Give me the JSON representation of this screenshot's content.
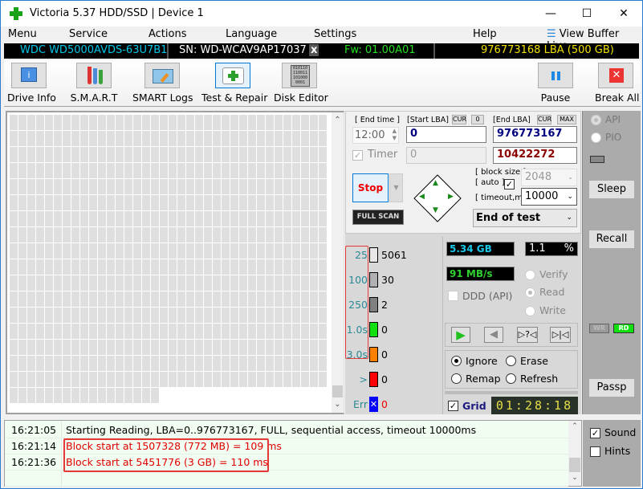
{
  "window": {
    "title": "Victoria 5.37 HDD/SSD | Device 1",
    "minimize": "—",
    "maximize": "☐",
    "close": "✕"
  },
  "menu": {
    "items": [
      "Menu",
      "Service",
      "Actions",
      "Language",
      "Settings",
      "Help"
    ],
    "view_buffer": "View Buffer Live"
  },
  "infobar": {
    "model": "WDC WD5000AVDS-63U7B1",
    "serial": "SN: WD-WCAV9AP17037",
    "close": "x",
    "firmware": "Fw: 01.00A01",
    "capacity": "976773168 LBA (500 GB)",
    "colors": {
      "model": "#00c8e8",
      "serial": "#ffffff",
      "firmware": "#22e022",
      "capacity": "#f0e000"
    }
  },
  "toolbar": {
    "buttons": [
      {
        "label": "Drive Info",
        "icon": "info-icon"
      },
      {
        "label": "S.M.A.R.T",
        "icon": "test-tubes-icon"
      },
      {
        "label": "SMART Logs",
        "icon": "folder-pencil-icon"
      },
      {
        "label": "Test & Repair",
        "icon": "first-aid-kit-icon",
        "active": true
      },
      {
        "label": "Disk Editor",
        "icon": "binary-file-icon"
      }
    ],
    "pause": "Pause",
    "break_all": "Break All"
  },
  "surface_grid": {
    "columns": 36,
    "full_rows": 17,
    "last_row_cells": 17
  },
  "test": {
    "end_time_label": "[ End time ]",
    "end_time_value": "12:00",
    "timer_label": "Timer",
    "timer_checked": true,
    "start_lba_label": "[Start LBA]",
    "cur_label": "CUR",
    "zero_label": "0",
    "start_lba_value": "0",
    "start_lba_current": "0",
    "end_lba_label": "[End LBA]",
    "max_label": "MAX",
    "end_lba_value": "976773167",
    "end_lba_current": "10422272",
    "stop_label": "Stop",
    "full_scan_label": "FULL SCAN",
    "block_size_label": "[ block size ]",
    "auto_label": "[ auto ]",
    "auto_checked": true,
    "block_size_value": "2048",
    "timeout_label": "[ timeout,ms ]",
    "timeout_value": "10000",
    "end_action_value": "End of test"
  },
  "legend": [
    {
      "label": "25",
      "count": "5061",
      "color": "#e8e8e8"
    },
    {
      "label": "100",
      "count": "30",
      "color": "#b0b0b4"
    },
    {
      "label": "250",
      "count": "2",
      "color": "#808080"
    },
    {
      "label": "1.0s",
      "count": "0",
      "color": "#10e010"
    },
    {
      "label": "3.0s",
      "count": "0",
      "color": "#ff8000"
    },
    {
      "label": ">",
      "count": "0",
      "color": "#ff0000"
    },
    {
      "label": "Err",
      "count": "0",
      "color": "#0000ff"
    }
  ],
  "stats": {
    "position": "5.34 GB",
    "percent": "1.1",
    "percent_sign": "%",
    "speed": "91 MB/s",
    "ddd_label": "DDD (API)",
    "ddd_checked": false,
    "modes": [
      {
        "label": "Verify",
        "selected": false
      },
      {
        "label": "Read",
        "selected": true
      },
      {
        "label": "Write",
        "selected": false
      }
    ],
    "repair_options": [
      {
        "label": "Ignore",
        "selected": true
      },
      {
        "label": "Erase",
        "selected": false
      },
      {
        "label": "Remap",
        "selected": false
      },
      {
        "label": "Refresh",
        "selected": false
      }
    ],
    "grid_label": "Grid",
    "grid_checked": true,
    "elapsed": "01:28:18"
  },
  "side": {
    "api_label": "API",
    "pio_label": "PIO",
    "sleep": "Sleep",
    "recall": "Recall",
    "wr": "WR",
    "rd": "RD",
    "passp": "Passp",
    "sound_label": "Sound",
    "sound_checked": true,
    "hints_label": "Hints",
    "hints_checked": false
  },
  "log": [
    {
      "time": "16:21:05",
      "message": "Starting Reading, LBA=0..976773167, FULL, sequential access, timeout 10000ms",
      "color": "#000000"
    },
    {
      "time": "16:21:14",
      "message": "Block start at 1507328 (772 MB)  = 109 ms",
      "color": "#e00000"
    },
    {
      "time": "16:21:36",
      "message": "Block start at 5451776 (3 GB)  = 110 ms",
      "color": "#e00000"
    }
  ]
}
